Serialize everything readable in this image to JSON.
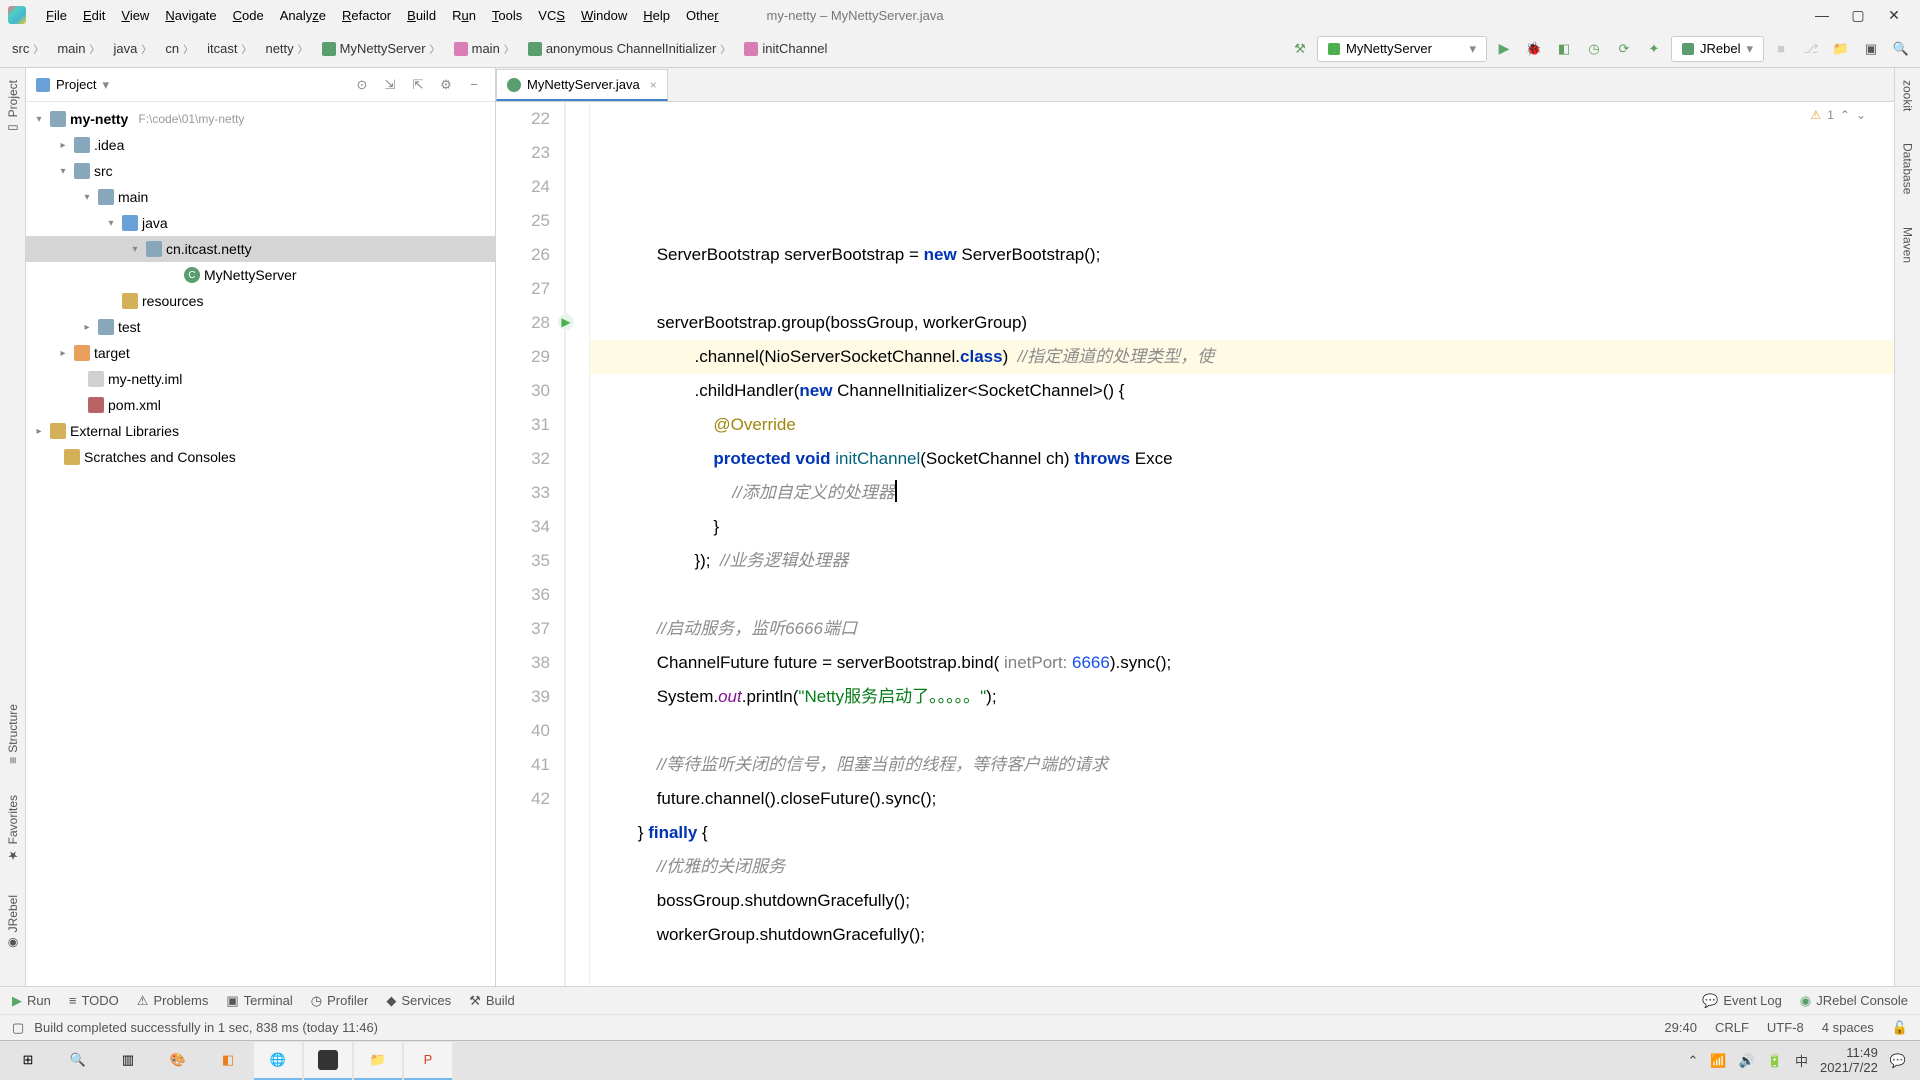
{
  "window": {
    "title": "my-netty – MyNettyServer.java",
    "menus": [
      "File",
      "Edit",
      "View",
      "Navigate",
      "Code",
      "Analyze",
      "Refactor",
      "Build",
      "Run",
      "Tools",
      "VCS",
      "Window",
      "Help",
      "Other"
    ]
  },
  "breadcrumbs": [
    "src",
    "main",
    "java",
    "cn",
    "itcast",
    "netty",
    "MyNettyServer",
    "main",
    "anonymous ChannelInitializer",
    "initChannel"
  ],
  "run_config": "MyNettyServer",
  "jrebel_label": "JRebel",
  "left_tabs": [
    "Project",
    "Structure",
    "Favorites",
    "JRebel"
  ],
  "right_tabs": [
    "zookit",
    "Database",
    "Maven"
  ],
  "project_panel": {
    "title": "Project"
  },
  "tree": {
    "root": {
      "name": "my-netty",
      "hint": "F:\\code\\01\\my-netty"
    },
    "idea": ".idea",
    "src": "src",
    "main": "main",
    "java": "java",
    "pkg": "cn.itcast.netty",
    "cls": "MyNettyServer",
    "resources": "resources",
    "test": "test",
    "target": "target",
    "iml": "my-netty.iml",
    "pom": "pom.xml",
    "ext": "External Libraries",
    "scratch": "Scratches and Consoles"
  },
  "tab": {
    "name": "MyNettyServer.java"
  },
  "code": {
    "lines_start": 22,
    "lines_end": 42,
    "l22a": "ServerBootstrap serverBootstrap = ",
    "l22b": "new",
    "l22c": " ServerBootstrap();",
    "l24a": "serverBootstrap.group(bossGroup, workerGroup)",
    "l25a": ".channel(NioServerSocketChannel.",
    "l25b": "class",
    "l25c": ")  ",
    "l25d": "//指定通道的处理类型，使",
    "l26a": ".childHandler(",
    "l26b": "new",
    "l26c": " ChannelInitializer<SocketChannel>() {",
    "l27a": "@Override",
    "l28a": "protected void",
    "l28b": " initChannel",
    "l28c": "(SocketChannel ch) ",
    "l28d": "throws",
    "l28e": " Exce",
    "l29a": "//添加自定义的处理器",
    "l30a": "}",
    "l31a": "});  ",
    "l31b": "//业务逻辑处理器",
    "l33a": "//启动服务，监听6666端口",
    "l34a": "ChannelFuture future = serverBootstrap.bind( ",
    "l34b": "inetPort:",
    "l34c": " 6666",
    "l34d": ").sync();",
    "l35a": "System.",
    "l35b": "out",
    "l35c": ".println(",
    "l35d": "\"Netty服务启动了。。。。。\"",
    "l35e": ");",
    "l37a": "//等待监听关闭的信号，阻塞当前的线程，等待客户端的请求",
    "l38a": "future.channel().closeFuture().sync();",
    "l39a": "} ",
    "l39b": "finally",
    "l39c": " {",
    "l40a": "//优雅的关闭服务",
    "l41a": "bossGroup.shutdownGracefully();",
    "l42a": "workerGroup.shutdownGracefully();"
  },
  "inspection": {
    "warnings": "1"
  },
  "bottom": {
    "run": "Run",
    "todo": "TODO",
    "problems": "Problems",
    "terminal": "Terminal",
    "profiler": "Profiler",
    "services": "Services",
    "build": "Build",
    "eventlog": "Event Log",
    "jrebel": "JRebel Console"
  },
  "status": {
    "msg": "Build completed successfully in 1 sec, 838 ms (today 11:46)",
    "pos": "29:40",
    "eol": "CRLF",
    "enc": "UTF-8",
    "indent": "4 spaces"
  },
  "taskbar": {
    "time": "11:49",
    "date": "2021/7/22"
  }
}
